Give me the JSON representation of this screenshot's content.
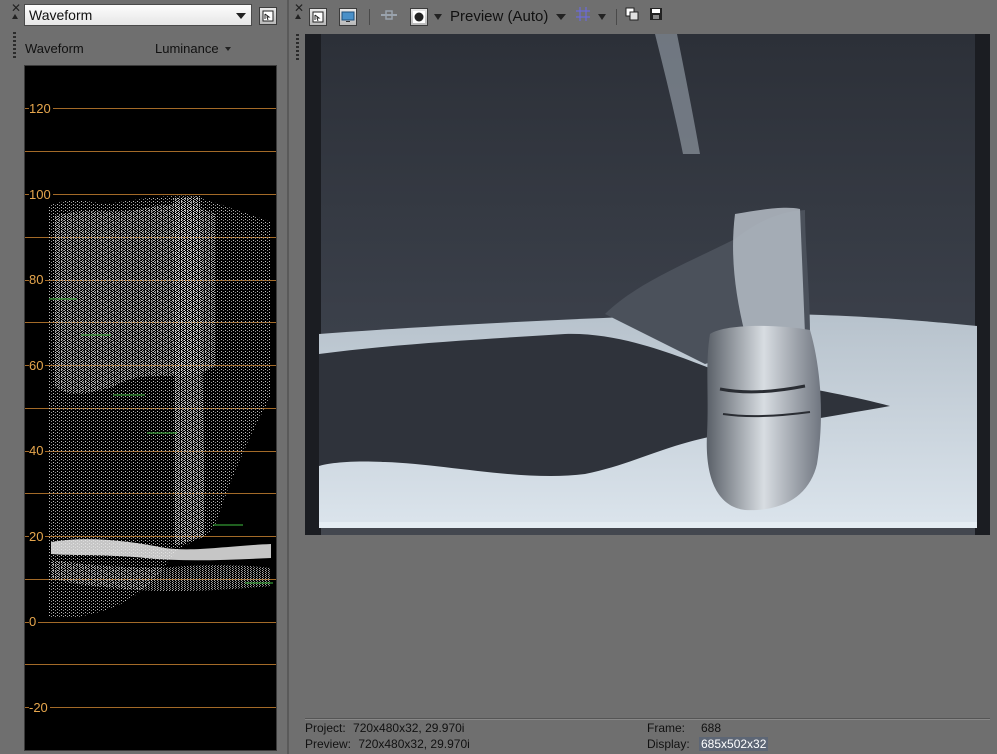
{
  "scope_panel": {
    "selector_value": "Waveform",
    "mode_label": "Waveform",
    "channel_label": "Luminance",
    "scale": {
      "ticks": [
        "120",
        "100",
        "80",
        "60",
        "40",
        "20",
        "0",
        "-20"
      ]
    }
  },
  "preview_panel": {
    "preview_quality": "Preview (Auto)"
  },
  "status": {
    "project_label": "Project:",
    "project_value": "720x480x32, 29.970i",
    "preview_label": "Preview:",
    "preview_value": "720x480x32, 29.970i",
    "frame_label": "Frame:",
    "frame_value": "688",
    "display_label": "Display:",
    "display_value": "685x502x32"
  },
  "colors": {
    "panel_bg": "#6f6f6f",
    "scope_bg": "#000000",
    "gridline": "#a36a28",
    "tick_text": "#e6a64d",
    "trace": "#e8e8e8",
    "trace_green": "#3fbf3f"
  },
  "icons": {
    "scope_settings": "scope-settings-icon",
    "preview_settings": "preview-settings-icon",
    "external_monitor": "monitor-icon",
    "split_screen": "split-screen-icon",
    "overlay": "overlay-icon",
    "grid": "grid-icon",
    "copy_snapshot": "copy-snapshot-icon",
    "save_snapshot": "save-snapshot-icon"
  }
}
